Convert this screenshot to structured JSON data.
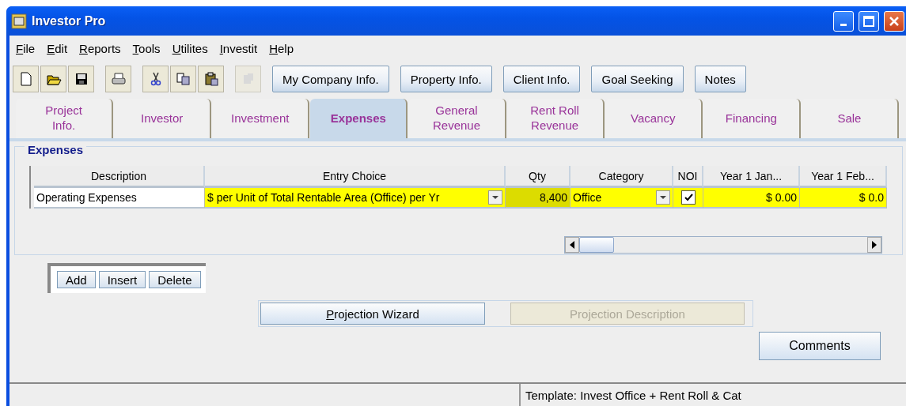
{
  "window": {
    "title": "Investor Pro"
  },
  "menu": [
    "File",
    "Edit",
    "Reports",
    "Tools",
    "Utilites",
    "Investit",
    "Help"
  ],
  "toolbar": {
    "icons": [
      {
        "kind": "new",
        "disabled": false
      },
      {
        "kind": "open",
        "disabled": false
      },
      {
        "kind": "save",
        "disabled": false
      },
      {
        "kind": "print",
        "disabled": false
      },
      {
        "kind": "cut",
        "disabled": false
      },
      {
        "kind": "copy",
        "disabled": false
      },
      {
        "kind": "paste",
        "disabled": false
      },
      {
        "kind": "export",
        "disabled": true
      }
    ],
    "buttons": [
      "My Company Info.",
      "Property Info.",
      "Client Info.",
      "Goal Seeking",
      "Notes"
    ]
  },
  "tabs": [
    {
      "label": "Project\nInfo.",
      "selected": false
    },
    {
      "label": "Investor",
      "selected": false
    },
    {
      "label": "Investment",
      "selected": false
    },
    {
      "label": "Expenses",
      "selected": true
    },
    {
      "label": "General\nRevenue",
      "selected": false
    },
    {
      "label": "Rent Roll\nRevenue",
      "selected": false
    },
    {
      "label": "Vacancy",
      "selected": false
    },
    {
      "label": "Financing",
      "selected": false
    },
    {
      "label": "Sale",
      "selected": false
    }
  ],
  "group": {
    "title": "Expenses",
    "table": {
      "columns": [
        "Description",
        "Entry Choice",
        "Qty",
        "Category",
        "NOI",
        "Year 1 Jan...",
        "Year 1 Feb..."
      ],
      "rows": [
        {
          "description": "Operating Expenses",
          "entry_choice": "$ per Unit of Total Rentable Area (Office) per Yr",
          "qty": "8,400",
          "category": "Office",
          "noi": true,
          "year_1_jan": "$ 0.00",
          "year_1_feb": "$ 0.0"
        }
      ]
    }
  },
  "row_buttons": [
    "Add",
    "Insert",
    "Delete"
  ],
  "projection": {
    "wizard": "Projection Wizard",
    "description": {
      "label": "Projection Description",
      "disabled": true
    }
  },
  "comments_button": "Comments",
  "status_bar": {
    "template": "Template: Invest Office + Rent Roll & Cat"
  }
}
